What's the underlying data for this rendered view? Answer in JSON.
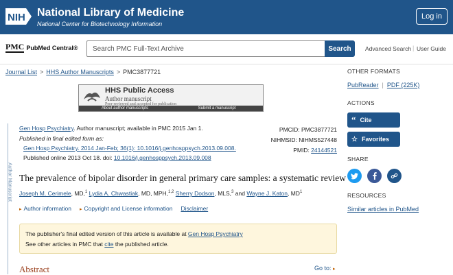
{
  "banner": {
    "logo_text": "NIH",
    "title": "National Library of Medicine",
    "subtitle": "National Center for Biotechnology Information",
    "login_label": "Log in",
    "color": "#20558a"
  },
  "pmc_header": {
    "logo_mark": "PMC",
    "logo_text": "PubMed Central®",
    "search_placeholder": "Search PMC Full-Text Archive",
    "search_button": "Search",
    "advanced_search": "Advanced Search",
    "separator": "|",
    "user_guide": "User Guide"
  },
  "breadcrumb": {
    "items": [
      "Journal List",
      "HHS Author Manuscripts",
      "PMC3877721"
    ],
    "separator": ">"
  },
  "hhs_box": {
    "title": "HHS Public Access",
    "subtitle": "Author manuscript",
    "peer_note": "Peer-reviewed and accepted for publication",
    "link_about": "About author manuscripts",
    "link_submit": "Submit a manuscript"
  },
  "side_label": "Author Manuscript",
  "citation": {
    "journal": "Gen Hosp Psychiatry",
    "line1_rest": ". Author manuscript; available in PMC 2015 Jan 1.",
    "published_label": "Published in final edited form as:",
    "published_ref": "Gen Hosp Psychiatry. 2014 Jan-Feb; 36(1): 10.1016/j.genhosppsych.2013.09.008.",
    "online_prefix": "Published online 2013 Oct 18. doi: ",
    "doi": "10.1016/j.genhosppsych.2013.09.008",
    "pmcid": "PMCID: PMC3877721",
    "nihmsid": "NIHMSID: NIHMS527448",
    "pmid_label": "PMID: ",
    "pmid": "24144521"
  },
  "article": {
    "title": "The prevalence of bipolar disorder in general primary care samples: a systematic review",
    "authors": [
      {
        "name": "Joseph M. Cerimele",
        "suffix": ", MD,",
        "sup": "1"
      },
      {
        "name": "Lydia A. Chwastiak",
        "suffix": ", MD, MPH,",
        "sup": "1,2"
      },
      {
        "name": "Sherry Dodson",
        "suffix": ", MLS,",
        "sup": "3"
      },
      {
        "name": "Wayne J. Katon",
        "suffix": ", MD",
        "sup": "1"
      }
    ],
    "author_joiner": "and",
    "info_links": [
      "Author information",
      "Copyright and License information",
      "Disclaimer"
    ],
    "notice_line1_prefix": "The publisher's final edited version of this article is available at ",
    "notice_line1_link": "Gen Hosp Psychiatry",
    "notice_line2_prefix": "See other articles in PMC that ",
    "notice_line2_link": "cite",
    "notice_line2_suffix": " the published article.",
    "abstract_heading": "Abstract",
    "goto_label": "Go to:"
  },
  "rail": {
    "other_formats": "OTHER FORMATS",
    "pubreader": "PubReader",
    "format_sep": "|",
    "pdf": "PDF (225K)",
    "actions": "ACTIONS",
    "cite_label": "Cite",
    "favorites_label": "Favorites",
    "share": "SHARE",
    "resources": "RESOURCES",
    "similar": "Similar articles in PubMed",
    "twitter_color": "#1d9bf0",
    "facebook_color": "#3b5998",
    "link_color": "#20558a"
  }
}
